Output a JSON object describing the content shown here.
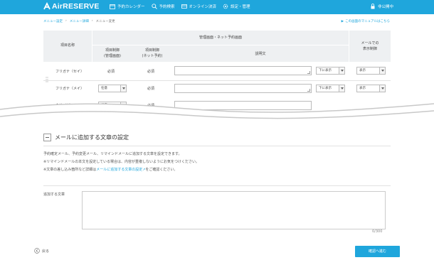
{
  "header": {
    "logo": "AirRESERVE",
    "nav": [
      {
        "label": "予約カレンダー",
        "icon": "calendar-icon"
      },
      {
        "label": "予約検索",
        "icon": "search-icon"
      },
      {
        "label": "オンライン決済",
        "icon": "card-icon"
      },
      {
        "label": "設定・管理",
        "icon": "gear-icon"
      }
    ],
    "user": "非公開中",
    "colors": {
      "brand": "#1fa6dc"
    }
  },
  "breadcrumb": [
    "メニュー設定",
    "メニュー詳細",
    "メニュー変更"
  ],
  "manual_link": "この画面のマニュアルはこちら",
  "table": {
    "col_item": "項目名称",
    "group_header": "管理画面・ネット予約画面",
    "col_control_admin": "項目制御\n(管理画面)",
    "col_control_net": "項目制御\n(ネット予約)",
    "col_desc": "説明文",
    "col_mail": "メールでの\n表示制御",
    "rows": [
      {
        "name": "フリガナ（セイ）",
        "admin": "必須",
        "net": "必須",
        "position": "下に表示",
        "mail": "表示"
      },
      {
        "name": "フリガナ（メイ）",
        "admin": "任意",
        "net": "必須",
        "position": "下に表示",
        "mail": "表示"
      },
      {
        "name": "会社（任）",
        "admin": "任意",
        "net": "必須"
      }
    ]
  },
  "section": {
    "title": "メールに追加する文章の設定",
    "desc1": "予約確定メール、予約変更メール、リマインドメールに追加する文章を設定できます。",
    "desc2": "※リマインドメールの本文を設定している場合は、内容が重複しないようにお気をつけください。",
    "desc3_pre": "※文章の差し込み箇所など詳細は",
    "desc3_link": "メールに追加する文章の設定",
    "desc3_post": "をご確認ください。",
    "field_label": "追加する文章",
    "counter": "0/300"
  },
  "footer": {
    "back": "戻る",
    "confirm": "確認へ進む"
  }
}
